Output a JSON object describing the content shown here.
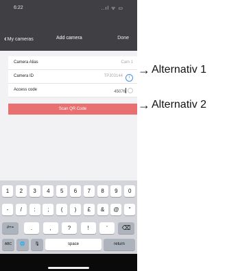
{
  "status": {
    "time": "6:22",
    "icons": "..ıl ᯤ ▭"
  },
  "nav": {
    "back_label": "My cameras",
    "title": "Add camera",
    "done_label": "Done"
  },
  "form": {
    "alias_label": "Camera Alias",
    "alias_placeholder": "Cam 1",
    "id_label": "Camera ID",
    "id_value": "TPJ03144",
    "access_label": "Access code",
    "access_value": "45076"
  },
  "scan_button": "Scan QR Code",
  "keyboard": {
    "row1": [
      "1",
      "2",
      "3",
      "4",
      "5",
      "6",
      "7",
      "8",
      "9",
      "0"
    ],
    "row2": [
      "-",
      "/",
      ":",
      ";",
      "(",
      ")",
      "£",
      "&",
      "@",
      "\""
    ],
    "row3": [
      ".",
      ",",
      "?",
      "!",
      "'"
    ],
    "shift_label": "#+=",
    "delete_label": "⌫",
    "abc_label": "ABC",
    "globe_label": "🌐",
    "mic_label": "🎙",
    "space_label": "space",
    "return_label": "return"
  },
  "callouts": {
    "alt1": "Alternativ 1",
    "alt2": "Alternativ 2"
  },
  "colors": {
    "nav_bg": "#3f3f44",
    "scan_button": "#e87070",
    "info_icon": "#4a8fe0"
  }
}
